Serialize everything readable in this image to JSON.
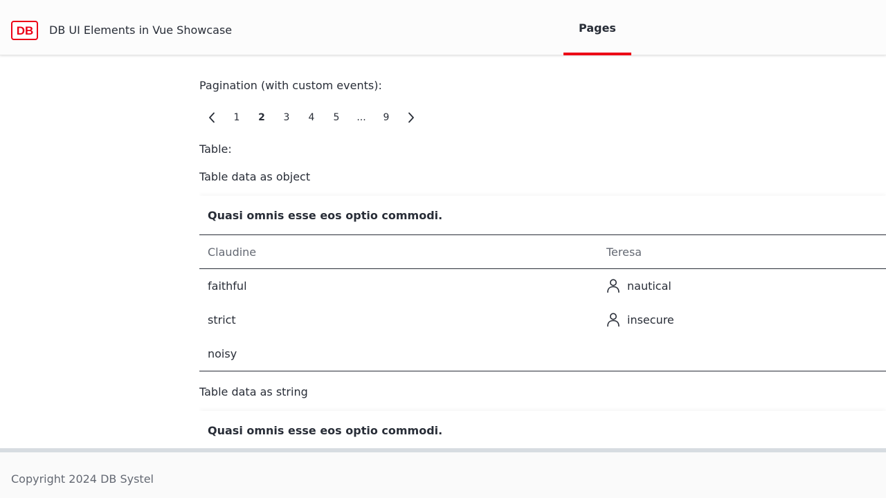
{
  "header": {
    "logo_text": "DB",
    "app_title": "DB UI Elements in Vue Showcase",
    "nav": [
      {
        "label": "Pages",
        "active": true
      }
    ],
    "accent_color": "#ec0016"
  },
  "main": {
    "pagination_label": "Pagination (with custom events):",
    "pagination": {
      "prev_icon": "chevron-left-icon",
      "next_icon": "chevron-right-icon",
      "pages": [
        "1",
        "2",
        "3",
        "4",
        "5",
        "...",
        "9"
      ],
      "current": "2"
    },
    "table_label": "Table:",
    "table_object_label": "Table data as object",
    "table_object": {
      "caption": "Quasi omnis esse eos optio commodi.",
      "headers": [
        "Claudine",
        "Teresa"
      ],
      "rows": [
        {
          "col1": "faithful",
          "col2": "nautical",
          "col2_icon": "person-icon"
        },
        {
          "col1": "strict",
          "col2": "insecure",
          "col2_icon": "person-icon"
        },
        {
          "col1": "noisy",
          "col2": ""
        }
      ]
    },
    "table_string_label": "Table data as string",
    "table_string": {
      "caption": "Quasi omnis esse eos optio commodi."
    }
  },
  "footer": {
    "copyright": "Copyright 2024 DB Systel"
  }
}
